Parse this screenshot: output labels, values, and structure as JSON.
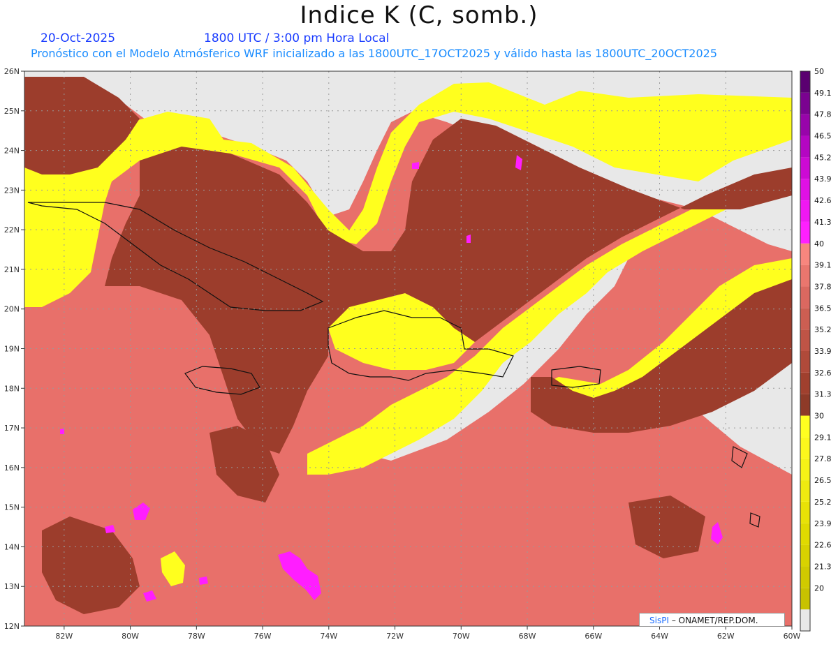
{
  "header": {
    "title": "Indice K (C, somb.)",
    "date": "20-Oct-2025",
    "time": "1800 UTC / 3:00 pm Hora Local",
    "description": "Pronóstico con el Modelo Atmósferico WRF inicializado a las 1800UTC_17OCT2025 y válido hasta las  1800UTC_20OCT2025"
  },
  "map": {
    "lon_range": [
      -83.2,
      -60
    ],
    "lat_range": [
      12,
      26
    ],
    "lon_ticks": [
      {
        "value": -82,
        "label": "82W"
      },
      {
        "value": -80,
        "label": "80W"
      },
      {
        "value": -78,
        "label": "78W"
      },
      {
        "value": -76,
        "label": "76W"
      },
      {
        "value": -74,
        "label": "74W"
      },
      {
        "value": -72,
        "label": "72W"
      },
      {
        "value": -70,
        "label": "70W"
      },
      {
        "value": -68,
        "label": "68W"
      },
      {
        "value": -66,
        "label": "66W"
      },
      {
        "value": -64,
        "label": "64W"
      },
      {
        "value": -62,
        "label": "62W"
      },
      {
        "value": -60,
        "label": "60W"
      }
    ],
    "lat_ticks": [
      {
        "value": 12,
        "label": "12N"
      },
      {
        "value": 13,
        "label": "13N"
      },
      {
        "value": 14,
        "label": "14N"
      },
      {
        "value": 15,
        "label": "15N"
      },
      {
        "value": 16,
        "label": "16N"
      },
      {
        "value": 17,
        "label": "17N"
      },
      {
        "value": 18,
        "label": "18N"
      },
      {
        "value": 19,
        "label": "19N"
      },
      {
        "value": 20,
        "label": "20N"
      },
      {
        "value": 21,
        "label": "21N"
      },
      {
        "value": 22,
        "label": "22N"
      },
      {
        "value": 23,
        "label": "23N"
      },
      {
        "value": 24,
        "label": "24N"
      },
      {
        "value": 25,
        "label": "25N"
      },
      {
        "value": 26,
        "label": "26N"
      }
    ],
    "colors": {
      "below": "#e8e8e8",
      "yellow": "#ffff1e",
      "salmon": "#e8706a",
      "red_mid": "#c9584d",
      "brown": "#9c3d2c",
      "magenta": "#ff1eff",
      "coast": "#111111"
    }
  },
  "colorbar": {
    "levels": [
      {
        "label": "",
        "color": "#e8e8e8"
      },
      {
        "label": "20",
        "color": "#c8c200"
      },
      {
        "label": "21.3",
        "color": "#d0ca00"
      },
      {
        "label": "22.6",
        "color": "#d8d200"
      },
      {
        "label": "23.9",
        "color": "#e0da00"
      },
      {
        "label": "25.2",
        "color": "#e8e206"
      },
      {
        "label": "26.5",
        "color": "#efea10"
      },
      {
        "label": "27.8",
        "color": "#f6f216"
      },
      {
        "label": "29.1",
        "color": "#fcf81c"
      },
      {
        "label": "30",
        "color": "#ffff20"
      },
      {
        "label": "31.3",
        "color": "#8e3a28"
      },
      {
        "label": "32.6",
        "color": "#a0402e"
      },
      {
        "label": "33.9",
        "color": "#b04a3a"
      },
      {
        "label": "35.2",
        "color": "#bf5446"
      },
      {
        "label": "36.5",
        "color": "#cc5e52"
      },
      {
        "label": "37.8",
        "color": "#db6860"
      },
      {
        "label": "39.1",
        "color": "#ea766e"
      },
      {
        "label": "40",
        "color": "#f8867e"
      },
      {
        "label": "41.3",
        "color": "#ff20ff"
      },
      {
        "label": "42.6",
        "color": "#f018f2"
      },
      {
        "label": "43.9",
        "color": "#e010e4"
      },
      {
        "label": "45.2",
        "color": "#cc0ad4"
      },
      {
        "label": "46.5",
        "color": "#b406c2"
      },
      {
        "label": "47.8",
        "color": "#9804aa"
      },
      {
        "label": "49.1",
        "color": "#7a0290"
      },
      {
        "label": "50",
        "color": "#5a0070"
      }
    ]
  },
  "credit": {
    "brand": "SisPI",
    "org": "– ONAMET/REP.DOM."
  }
}
